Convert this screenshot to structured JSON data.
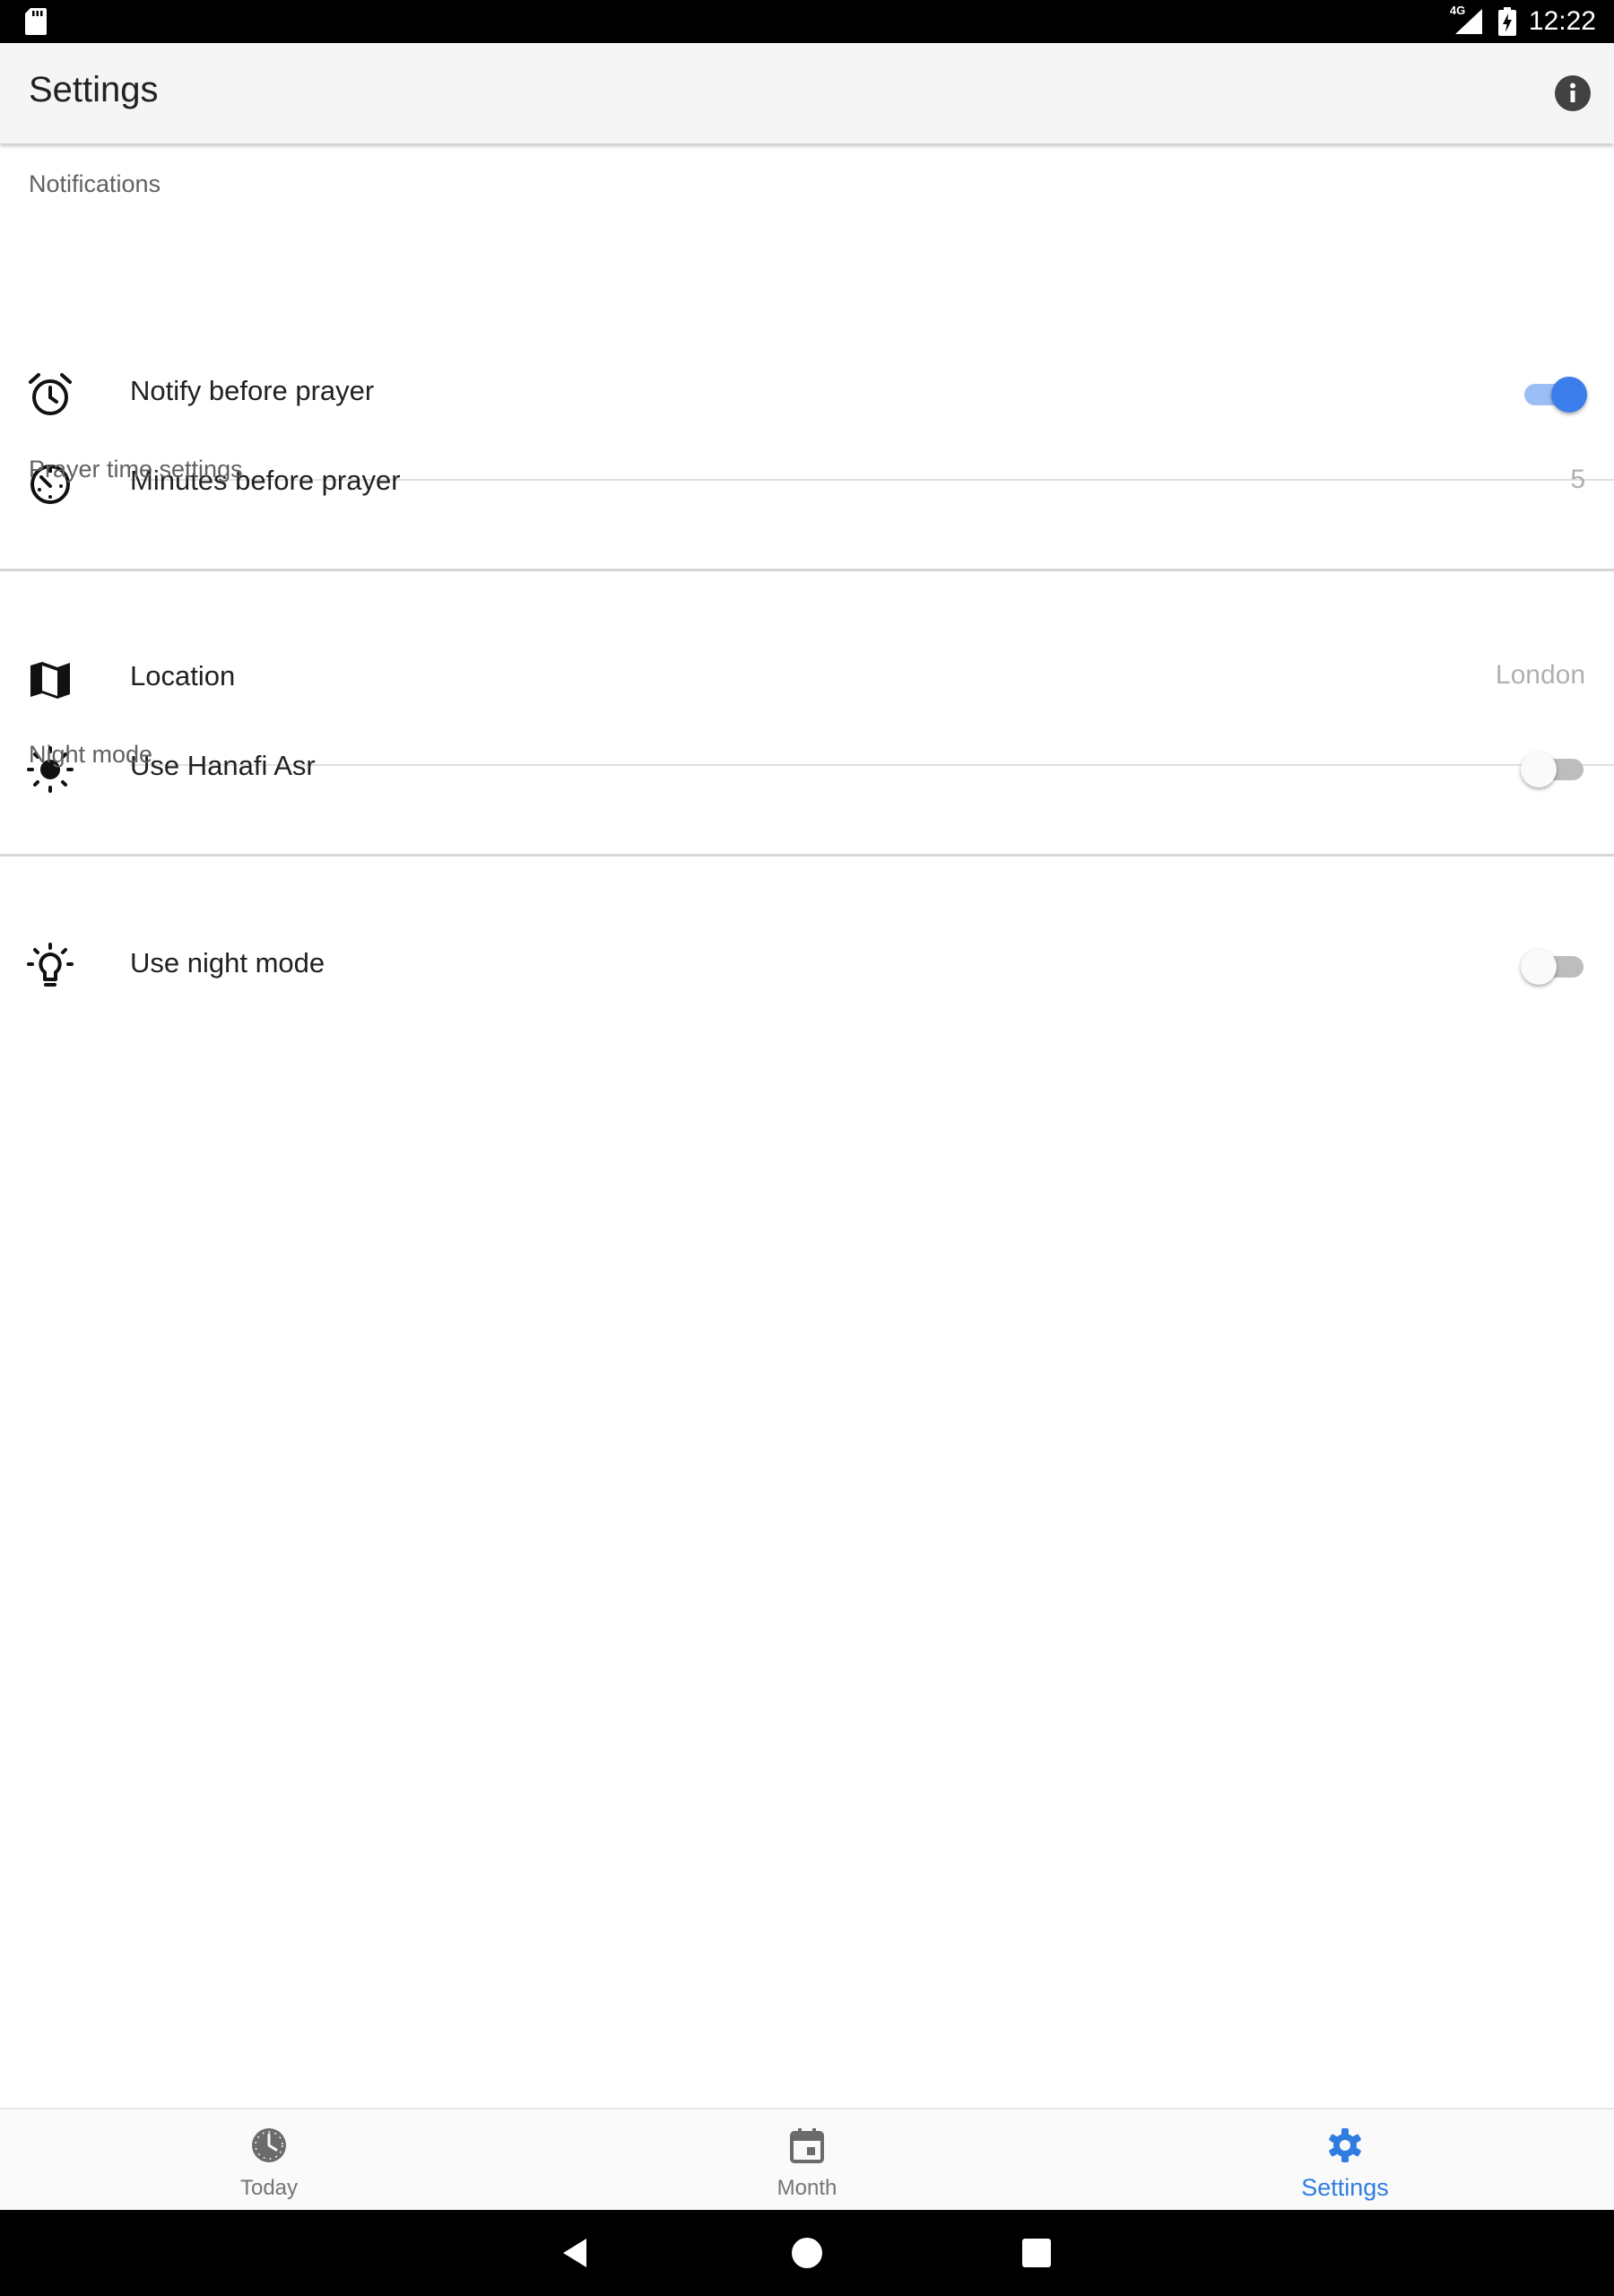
{
  "status_bar": {
    "time": "12:22",
    "network": "4G",
    "icons": [
      "sd-card-icon",
      "signal-icon",
      "battery-charging-icon"
    ]
  },
  "app_bar": {
    "title": "Settings",
    "action_icon": "info-icon"
  },
  "sections": {
    "notifications": {
      "header": "Notifications",
      "notify_before_prayer": {
        "label": "Notify before prayer",
        "icon": "alarm-clock-icon",
        "enabled": true
      },
      "minutes_before_prayer": {
        "label": "Minutes before prayer",
        "icon": "timer-icon",
        "value": "5"
      }
    },
    "prayer_time": {
      "header": "Prayer time settings",
      "location": {
        "label": "Location",
        "icon": "map-icon",
        "value": "London"
      },
      "hanafi_asr": {
        "label": "Use Hanafi Asr",
        "icon": "sun-icon",
        "enabled": false
      }
    },
    "night_mode": {
      "header": "Night mode",
      "use_night_mode": {
        "label": "Use night mode",
        "icon": "lightbulb-icon",
        "enabled": false
      }
    }
  },
  "bottom_nav": {
    "items": [
      {
        "label": "Today",
        "icon": "clock-icon",
        "active": false
      },
      {
        "label": "Month",
        "icon": "calendar-icon",
        "active": false
      },
      {
        "label": "Settings",
        "icon": "gear-icon",
        "active": true
      }
    ]
  },
  "colors": {
    "accent": "#3b7deb",
    "accent_track": "#9cbef6",
    "active_nav": "#2f7de1",
    "app_bar_bg": "#f5f5f5"
  }
}
